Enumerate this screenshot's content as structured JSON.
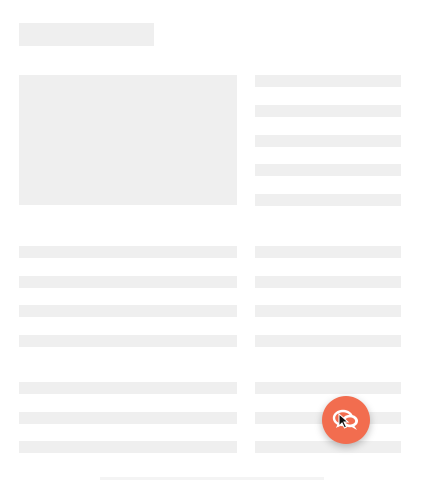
{
  "page": {
    "state": "loading",
    "background": "#ffffff",
    "skeleton_color": "#efefef"
  },
  "chat_button": {
    "icon": "chat-bubbles-icon",
    "color": "#f26d4f"
  },
  "cursor": {
    "icon": "arrow-pointer-icon"
  }
}
